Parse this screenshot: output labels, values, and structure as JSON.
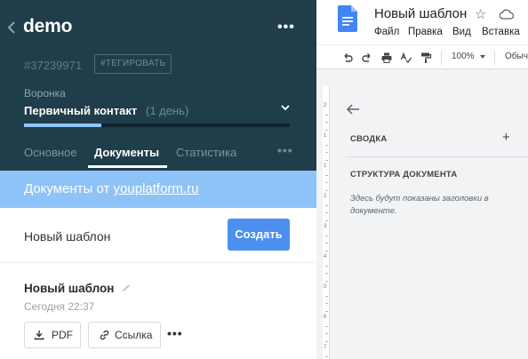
{
  "crm": {
    "lead_title": "demo",
    "lead_id": "#37239971",
    "tag_button": "#ТЕГИРОВАТЬ",
    "funnel": {
      "label": "Воронка",
      "stage": "Первичный контакт",
      "days": "(1 день)",
      "progress_fraction": 0.29
    },
    "tabs": [
      {
        "label": "Основное"
      },
      {
        "label": "Документы"
      },
      {
        "label": "Статистика"
      }
    ],
    "active_tab": "Документы",
    "banner": {
      "prefix": "Документы от ",
      "link": "youplatform.ru"
    },
    "template": {
      "name": "Новый шаблон",
      "create_label": "Создать"
    },
    "document": {
      "title": "Новый шаблон",
      "time": "Сегодня 22:37",
      "pdf_label": "PDF",
      "link_label": "Ссылка"
    },
    "colors": {
      "header_bg": "#1f3d4a",
      "banner_bg": "#8ec3f7",
      "accent": "#4c8fef",
      "progress": "#8ec6ff"
    }
  },
  "gdocs": {
    "title": "Новый шаблон",
    "menu": [
      "Файл",
      "Правка",
      "Вид",
      "Вставка"
    ],
    "toolbar": {
      "icons": [
        "undo-icon",
        "redo-icon",
        "print-icon",
        "spellcheck-icon",
        "paint-format-icon"
      ],
      "zoom": "100%",
      "style": "Обыч"
    },
    "ruler_numbers": [
      "2",
      "1",
      "1",
      "2",
      "3",
      "4",
      "5",
      "6",
      "7"
    ],
    "outline": {
      "summary_label": "СВОДКА",
      "structure_label": "СТРУКТУРА ДОКУМЕНТА",
      "hint": "Здесь будут показаны заголовки в документе."
    }
  }
}
